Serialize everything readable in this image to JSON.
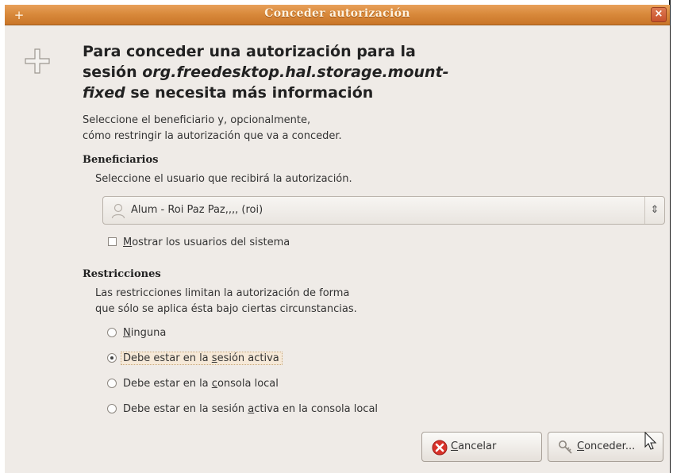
{
  "window": {
    "title": "Conceder autorización",
    "menu_glyph": "+",
    "close_glyph": "×"
  },
  "heading": {
    "line1": "Para conceder una autorización para la",
    "line2_pre": "sesión ",
    "line2_italic": "org.freedesktop.hal.storage.mount-",
    "line3_italic": "fixed",
    "line3_post": " se necesita más información"
  },
  "intro": {
    "line1": "Seleccione el beneficiario y, opcionalmente,",
    "line2": "cómo restringir la autorización que va a conceder."
  },
  "beneficiaries": {
    "title": "Beneficiarios",
    "subtitle": "Seleccione el usuario que recibirá la autorización.",
    "selected_user": "Alum - Roi Paz Paz,,,, (roi)",
    "show_system_users": {
      "mnemonic": "M",
      "rest": "ostrar los usuarios del sistema",
      "checked": false
    }
  },
  "restrictions": {
    "title": "Restricciones",
    "subtitle_line1": "Las restricciones limitan la autorización de forma",
    "subtitle_line2": "que sólo se aplica ésta bajo ciertas circunstancias.",
    "options": [
      {
        "pre": "",
        "mnemonic": "N",
        "post": "inguna",
        "selected": false
      },
      {
        "pre": "Debe estar en la ",
        "mnemonic": "s",
        "post": "esión activa",
        "selected": true
      },
      {
        "pre": "Debe estar en la ",
        "mnemonic": "c",
        "post": "onsola local",
        "selected": false
      },
      {
        "pre": "Debe estar en la sesión ",
        "mnemonic": "a",
        "post": "ctiva en la consola local",
        "selected": false
      }
    ]
  },
  "buttons": {
    "cancel": {
      "mnemonic": "C",
      "rest": "ancelar"
    },
    "grant": {
      "mnemonic": "C",
      "rest": "onceder..."
    }
  },
  "colors": {
    "titlebar": "#d98a3c",
    "dialog_bg": "#efebe7",
    "cancel_icon": "#d8322a"
  }
}
